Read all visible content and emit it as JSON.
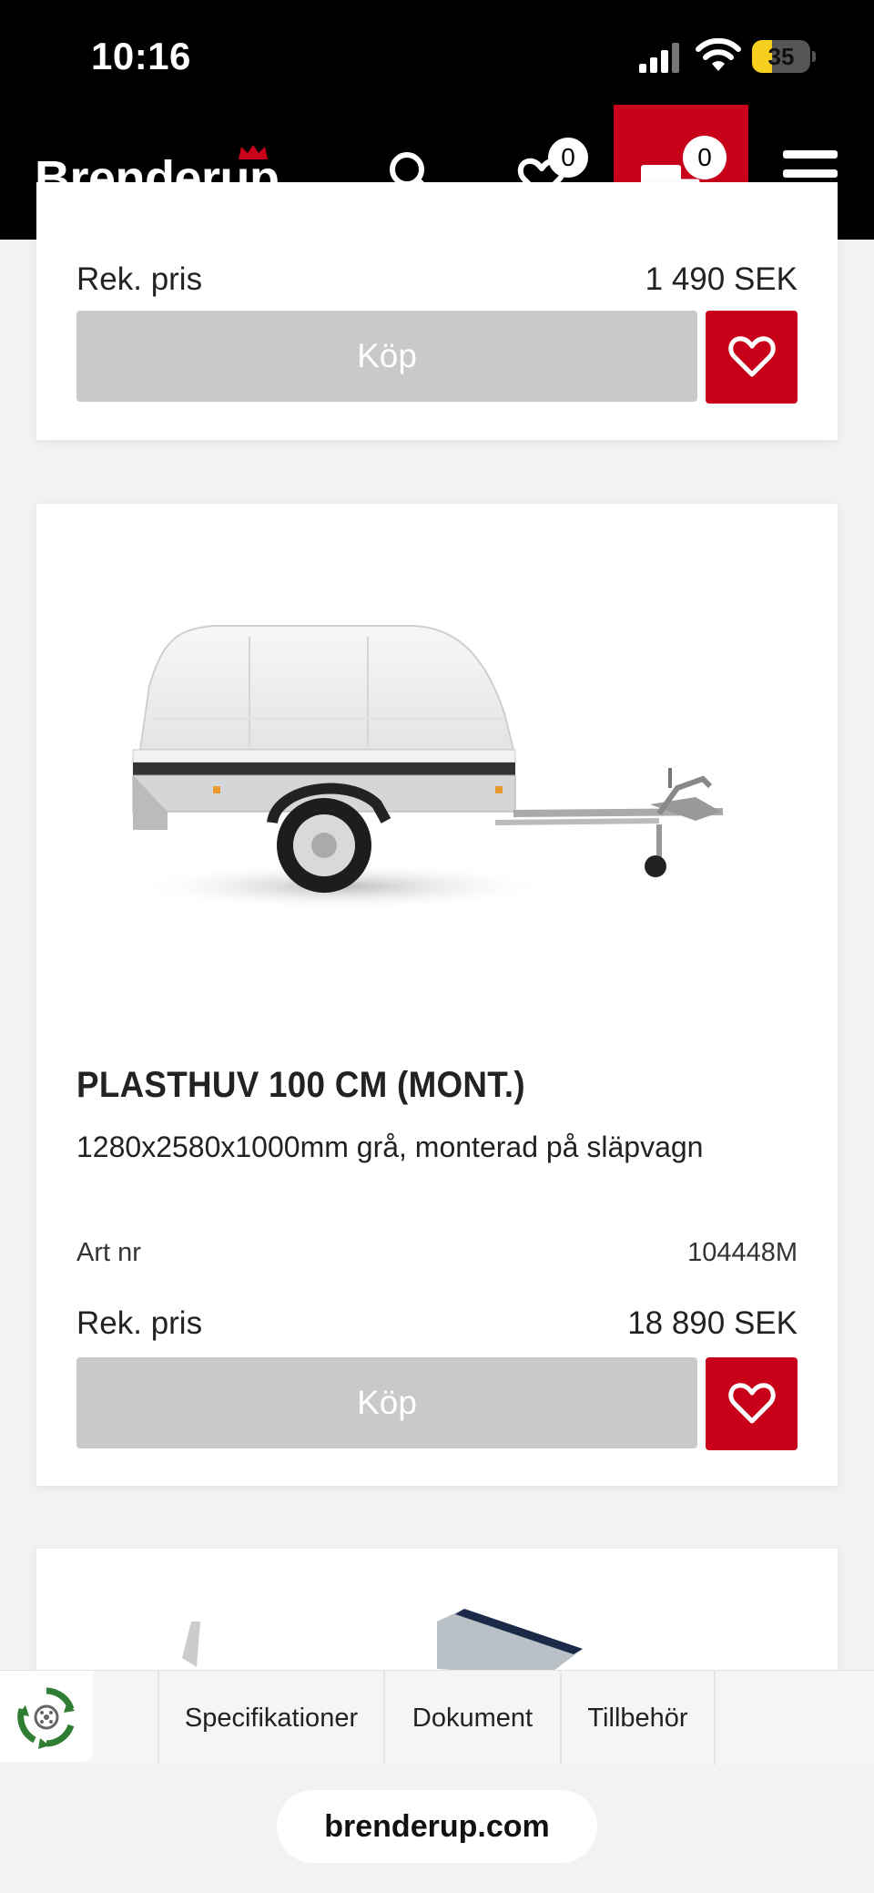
{
  "status_bar": {
    "time": "10:16",
    "battery": "35",
    "battery_level": 0.35
  },
  "header": {
    "logo_text": "Brenderup",
    "wishlist_count": "0",
    "cart_count": "0",
    "brand_color": "#c8001a"
  },
  "cards": [
    {
      "price_label": "Rek. pris",
      "price_value": "1 490 SEK",
      "buy_label": "Köp"
    },
    {
      "title": "PLASTHUV 100 CM (MONT.)",
      "description": "1280x2580x1000mm grå, monterad på släpvagn",
      "art_label": "Art nr",
      "art_value": "104448M",
      "price_label": "Rek. pris",
      "price_value": "18 890 SEK",
      "buy_label": "Köp"
    }
  ],
  "tabs": [
    {
      "label": "Specifikationer"
    },
    {
      "label": "Dokument"
    },
    {
      "label": "Tillbehör"
    }
  ],
  "browser": {
    "url": "brenderup.com"
  },
  "icons": [
    "search-icon",
    "heart-icon",
    "cart-trailer-icon",
    "menu-icon",
    "recycle-logo-icon"
  ]
}
